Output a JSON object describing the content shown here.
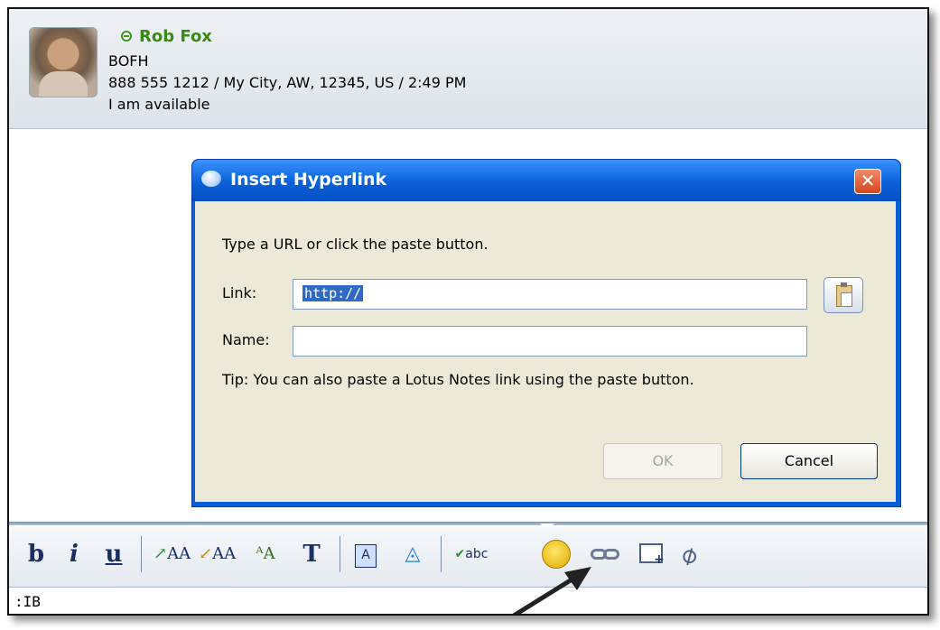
{
  "contact": {
    "name": "Rob Fox",
    "title": "BOFH",
    "details": "888 555 1212 / My City, AW, 12345, US / 2:49 PM",
    "status": "I am available"
  },
  "dialog": {
    "title": "Insert Hyperlink",
    "close_glyph": "✕",
    "instruction": "Type a URL or click the paste button.",
    "link_label": "Link:",
    "link_value": "http://",
    "name_label": "Name:",
    "name_value": "",
    "tip": "Tip: You can also paste a Lotus Notes link using the paste button.",
    "ok_label": "OK",
    "cancel_label": "Cancel"
  },
  "toolbar": {
    "bold": "b",
    "italic": "i",
    "underline": "u",
    "text": "T",
    "icons": [
      "bold-icon",
      "italic-icon",
      "underline-icon",
      "grow-font-icon",
      "shrink-font-icon",
      "font-icon",
      "text-style-icon",
      "font-color-icon",
      "highlight-icon",
      "spellcheck-icon",
      "emoticon-icon",
      "link-icon",
      "screen-capture-icon",
      "attach-icon"
    ]
  },
  "input": {
    "text": ":IB"
  },
  "colors": {
    "accent": "#0a5fd8",
    "online": "#3a9a22"
  }
}
